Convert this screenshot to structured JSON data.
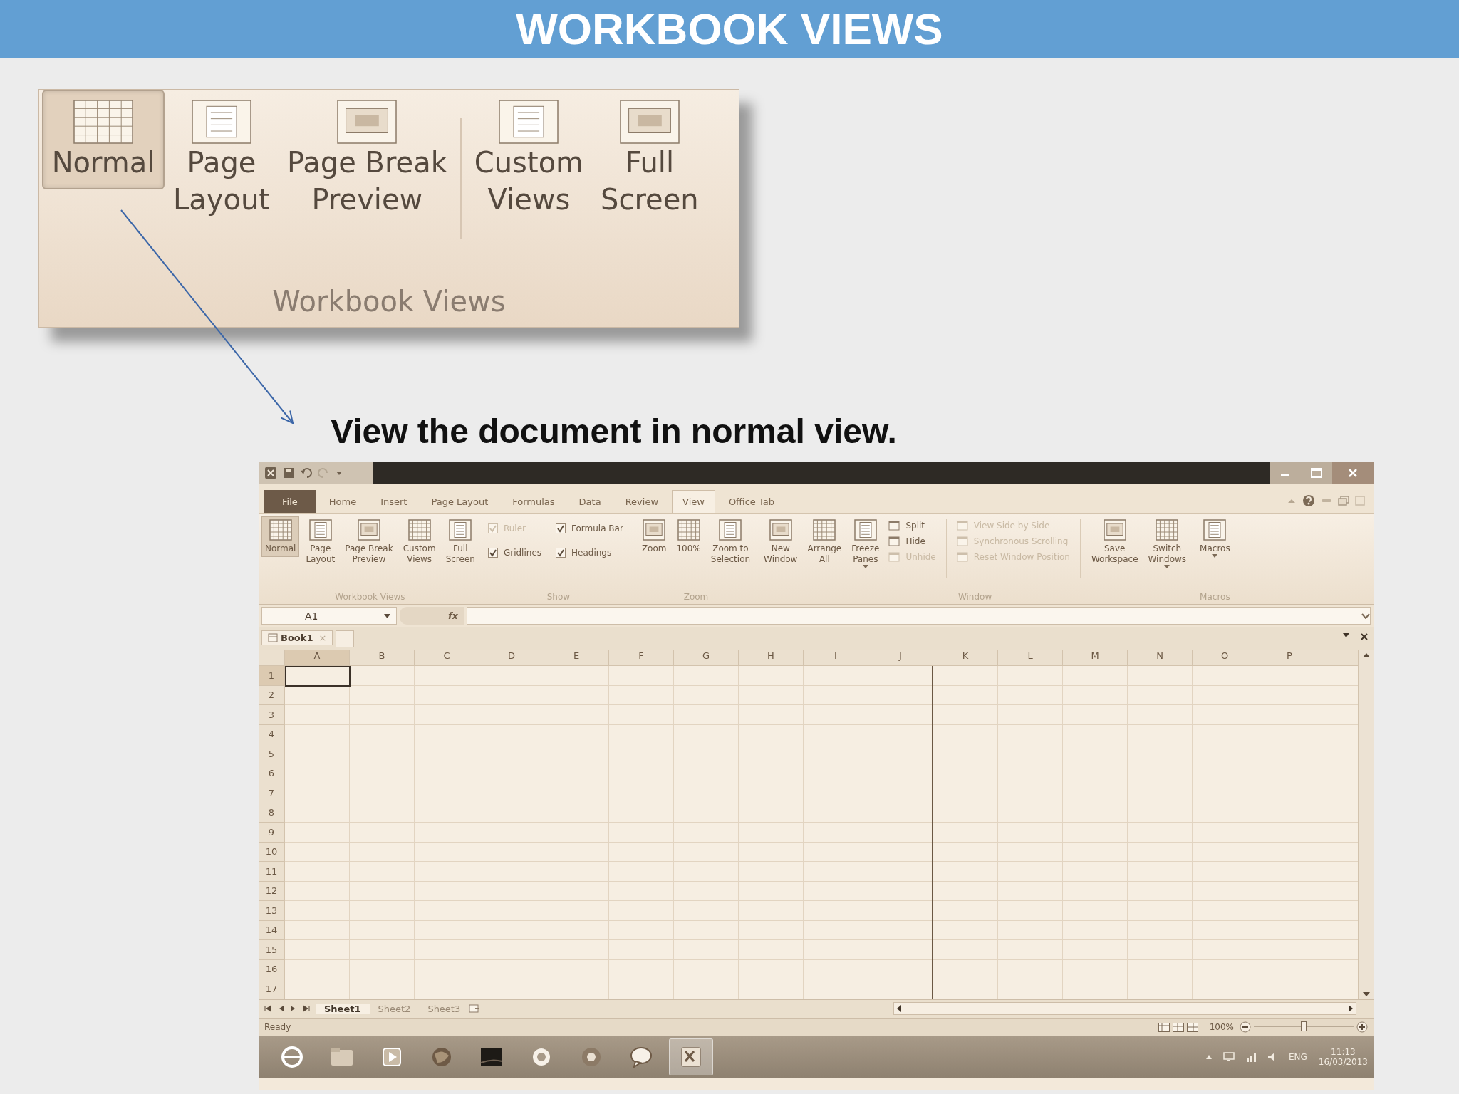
{
  "slide_title": "WORKBOOK VIEWS",
  "callout": {
    "buttons": [
      {
        "label": "Normal",
        "selected": true
      },
      {
        "label": "Page\nLayout",
        "selected": false
      },
      {
        "label": "Page Break\nPreview",
        "selected": false
      },
      {
        "label": "Custom\nViews",
        "selected": false,
        "separator_before": true
      },
      {
        "label": "Full\nScreen",
        "selected": false
      }
    ],
    "group_label": "Workbook Views"
  },
  "caption": "View the document in normal view.",
  "excel": {
    "tabs": [
      {
        "label": "File",
        "kind": "file",
        "selected": false
      },
      {
        "label": "Home",
        "kind": "tab",
        "selected": false
      },
      {
        "label": "Insert",
        "kind": "tab",
        "selected": false
      },
      {
        "label": "Page Layout",
        "kind": "tab",
        "selected": false
      },
      {
        "label": "Formulas",
        "kind": "tab",
        "selected": false
      },
      {
        "label": "Data",
        "kind": "tab",
        "selected": false
      },
      {
        "label": "Review",
        "kind": "tab",
        "selected": false
      },
      {
        "label": "View",
        "kind": "tab",
        "selected": true
      },
      {
        "label": "Office Tab",
        "kind": "tab",
        "selected": false
      }
    ],
    "ribbon_groups": [
      {
        "label": "Workbook Views",
        "columns": [
          {
            "kind": "big",
            "label": "Normal",
            "selected": true
          },
          {
            "kind": "big",
            "label": "Page\nLayout",
            "selected": false
          },
          {
            "kind": "big",
            "label": "Page Break\nPreview",
            "selected": false
          },
          {
            "kind": "big",
            "label": "Custom\nViews",
            "selected": false
          },
          {
            "kind": "big",
            "label": "Full\nScreen",
            "selected": false
          }
        ]
      },
      {
        "label": "Show",
        "columns": [
          {
            "kind": "checks",
            "items": [
              {
                "label": "Ruler",
                "checked": true,
                "disabled": true
              },
              {
                "label": "Gridlines",
                "checked": true,
                "disabled": false
              }
            ]
          },
          {
            "kind": "checks",
            "items": [
              {
                "label": "Formula Bar",
                "checked": true,
                "disabled": false
              },
              {
                "label": "Headings",
                "checked": true,
                "disabled": false
              }
            ]
          }
        ]
      },
      {
        "label": "Zoom",
        "columns": [
          {
            "kind": "big",
            "label": "Zoom"
          },
          {
            "kind": "big",
            "label": "100%"
          },
          {
            "kind": "big",
            "label": "Zoom to\nSelection"
          }
        ]
      },
      {
        "label": "Window",
        "columns": [
          {
            "kind": "big",
            "label": "New\nWindow"
          },
          {
            "kind": "big",
            "label": "Arrange\nAll"
          },
          {
            "kind": "big",
            "label": "Freeze\nPanes",
            "dropdown": true
          },
          {
            "kind": "smalls",
            "items": [
              {
                "label": "Split",
                "disabled": false
              },
              {
                "label": "Hide",
                "disabled": false
              },
              {
                "label": "Unhide",
                "disabled": true
              }
            ]
          },
          {
            "kind": "smalls",
            "separator_before": true,
            "items": [
              {
                "label": "View Side by Side",
                "disabled": true
              },
              {
                "label": "Synchronous Scrolling",
                "disabled": true
              },
              {
                "label": "Reset Window Position",
                "disabled": true
              }
            ]
          },
          {
            "kind": "big",
            "label": "Save\nWorkspace",
            "separator_before": true
          },
          {
            "kind": "big",
            "label": "Switch\nWindows",
            "dropdown": true
          }
        ]
      },
      {
        "label": "Macros",
        "columns": [
          {
            "kind": "big",
            "label": "Macros",
            "dropdown": true
          }
        ]
      }
    ],
    "name_box": "A1",
    "formula_label": "fx",
    "workbook_tab": {
      "label": "Book1",
      "close": "×"
    },
    "columns": [
      {
        "label": "A",
        "selected": true
      },
      {
        "label": "B",
        "selected": false
      },
      {
        "label": "C",
        "selected": false
      },
      {
        "label": "D",
        "selected": false
      },
      {
        "label": "E",
        "selected": false
      },
      {
        "label": "F",
        "selected": false
      },
      {
        "label": "G",
        "selected": false
      },
      {
        "label": "H",
        "selected": false
      },
      {
        "label": "I",
        "selected": false
      },
      {
        "label": "J",
        "selected": false
      },
      {
        "label": "K",
        "selected": false
      },
      {
        "label": "L",
        "selected": false
      },
      {
        "label": "M",
        "selected": false
      },
      {
        "label": "N",
        "selected": false
      },
      {
        "label": "O",
        "selected": false
      },
      {
        "label": "P",
        "selected": false
      }
    ],
    "rows": [
      {
        "label": "1",
        "selected": true
      },
      {
        "label": "2",
        "selected": false
      },
      {
        "label": "3",
        "selected": false
      },
      {
        "label": "4",
        "selected": false
      },
      {
        "label": "5",
        "selected": false
      },
      {
        "label": "6",
        "selected": false
      },
      {
        "label": "7",
        "selected": false
      },
      {
        "label": "8",
        "selected": false
      },
      {
        "label": "9",
        "selected": false
      },
      {
        "label": "10",
        "selected": false
      },
      {
        "label": "11",
        "selected": false
      },
      {
        "label": "12",
        "selected": false
      },
      {
        "label": "13",
        "selected": false
      },
      {
        "label": "14",
        "selected": false
      },
      {
        "label": "15",
        "selected": false
      },
      {
        "label": "16",
        "selected": false
      },
      {
        "label": "17",
        "selected": false
      }
    ],
    "sheet_tabs": [
      {
        "label": "Sheet1",
        "selected": true
      },
      {
        "label": "Sheet2",
        "selected": false
      },
      {
        "label": "Sheet3",
        "selected": false
      }
    ],
    "status": "Ready",
    "zoom_text": "100%",
    "zoom_slider": {
      "level": 0.5
    },
    "taskbar": {
      "apps": [
        {
          "kind": "browser",
          "selected": false
        },
        {
          "kind": "folder",
          "selected": false
        },
        {
          "kind": "media",
          "selected": false
        },
        {
          "kind": "globe",
          "selected": false
        },
        {
          "kind": "dark",
          "selected": false
        },
        {
          "kind": "skype",
          "selected": false
        },
        {
          "kind": "chrome",
          "selected": false
        },
        {
          "kind": "chat",
          "selected": false
        },
        {
          "kind": "excel",
          "selected": true
        }
      ],
      "language": "ENG",
      "time": "11:13",
      "date": "16/03/2013"
    }
  }
}
